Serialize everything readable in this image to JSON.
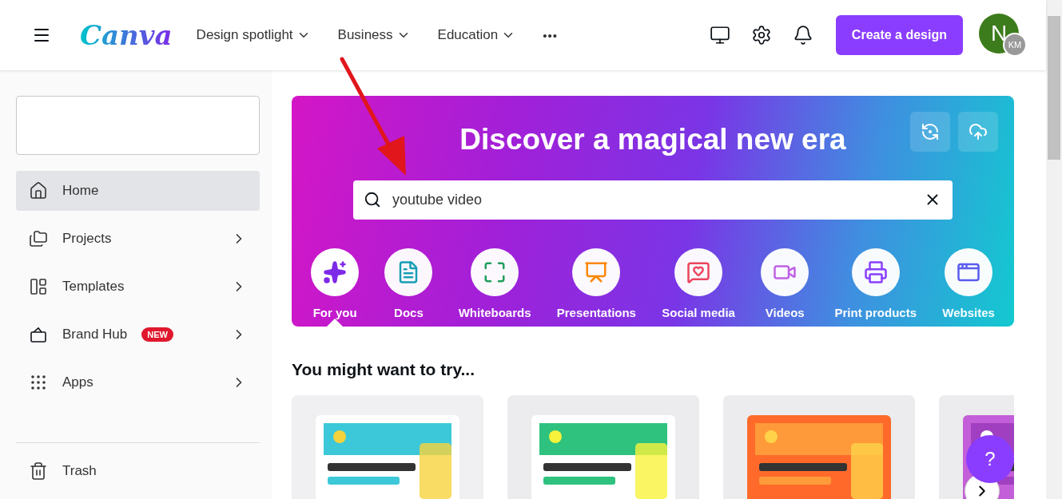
{
  "header": {
    "logo": "Canva",
    "nav": [
      {
        "label": "Design spotlight"
      },
      {
        "label": "Business"
      },
      {
        "label": "Education"
      }
    ],
    "more": "•••",
    "create_button": "Create a design",
    "avatar": {
      "initial": "N",
      "badge": "KM"
    }
  },
  "sidebar": {
    "items": [
      {
        "label": "Home",
        "selected": true,
        "chevron": false
      },
      {
        "label": "Projects",
        "selected": false,
        "chevron": true
      },
      {
        "label": "Templates",
        "selected": false,
        "chevron": true
      },
      {
        "label": "Brand Hub",
        "selected": false,
        "chevron": true,
        "badge": "NEW"
      },
      {
        "label": "Apps",
        "selected": false,
        "chevron": true
      }
    ],
    "bottom_items": [
      {
        "label": "Trash"
      }
    ]
  },
  "hero": {
    "title": "Discover a magical new era",
    "search": {
      "value": "youtube video"
    },
    "categories": [
      {
        "label": "For you",
        "selected": true
      },
      {
        "label": "Docs",
        "selected": false
      },
      {
        "label": "Whiteboards",
        "selected": false
      },
      {
        "label": "Presentations",
        "selected": false
      },
      {
        "label": "Social media",
        "selected": false
      },
      {
        "label": "Videos",
        "selected": false
      },
      {
        "label": "Print products",
        "selected": false
      },
      {
        "label": "Websites",
        "selected": false
      }
    ]
  },
  "suggestions": {
    "title": "You might want to try..."
  },
  "help_button": "?"
}
